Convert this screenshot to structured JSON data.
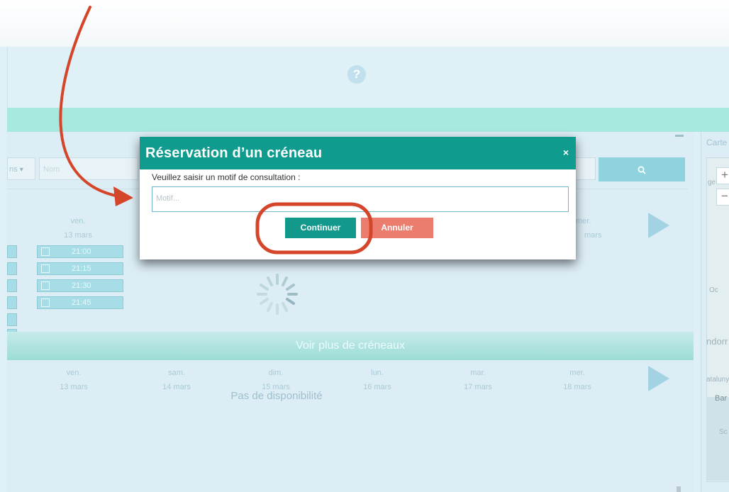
{
  "help_icon_text": "?",
  "colors": {
    "modal_header": "#0f9b8e",
    "continue": "#13988c",
    "cancel": "#ec7d6e",
    "annotation": "#d4452a"
  },
  "filters": {
    "select_value": "ns",
    "select_arrow": "▾",
    "name_placeholder": "Nom"
  },
  "search_icon": "search-icon",
  "map": {
    "title": "Carte",
    "zoom_in": "+",
    "zoom_out": "−",
    "labels": [
      "ge",
      "Oc",
      "ndorr",
      "ataluny",
      "Bar",
      "Sc"
    ]
  },
  "week1": {
    "days": [
      {
        "day": "ven.",
        "date": "13 mars"
      },
      {
        "day": "mer.",
        "date": "mars"
      }
    ],
    "slots": [
      "21:00",
      "21:15",
      "21:30",
      "21:45"
    ]
  },
  "voir_plus": "Voir plus de créneaux",
  "week2": {
    "days": [
      {
        "day": "ven.",
        "date": "13 mars"
      },
      {
        "day": "sam.",
        "date": "14 mars"
      },
      {
        "day": "dim.",
        "date": "15 mars"
      },
      {
        "day": "lun.",
        "date": "16 mars"
      },
      {
        "day": "mar.",
        "date": "17 mars"
      },
      {
        "day": "mer.",
        "date": "18 mars"
      }
    ],
    "empty_message": "Pas de disponibilité"
  },
  "modal": {
    "title": "Réservation d’un créneau",
    "close": "×",
    "label": "Veuillez saisir un motif de consultation :",
    "input_placeholder": "Motif...",
    "continue_label": "Continuer",
    "cancel_label": "Annuler"
  }
}
